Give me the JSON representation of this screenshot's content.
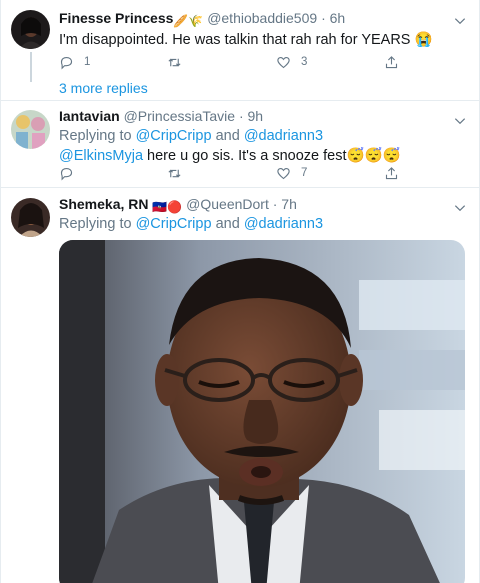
{
  "tweets": [
    {
      "display_name": "Finesse Princess",
      "name_emojis": "🥖🌾",
      "handle": "@ethiobaddie509",
      "time": "· 6h",
      "text": "I'm disappointed. He was talkin that rah rah for YEARS 😭",
      "reply_count": "1",
      "retweet_count": "",
      "like_count": "3",
      "more_replies": "3 more replies"
    },
    {
      "display_name": "Iantavian",
      "handle": "@PrincessiaTavie",
      "time": "· 9h",
      "replying_prefix": "Replying to",
      "replying_to_1": "@CripCripp",
      "replying_and": "and",
      "replying_to_2": "@dadriann3",
      "mention": "@ElkinsMyja",
      "text": " here u go sis. It's a snooze fest",
      "trailing_emojis": "😴😴😴",
      "reply_count": "",
      "retweet_count": "",
      "like_count": "7"
    },
    {
      "display_name": "Shemeka, RN",
      "name_emojis": "🇭🇹🔴",
      "handle": "@QueenDort",
      "time": "· 7h",
      "replying_prefix": "Replying to",
      "replying_to_1": "@CripCripp",
      "replying_and": "and",
      "replying_to_2": "@dadriann3"
    }
  ],
  "icons": {
    "reply": "reply-icon",
    "retweet": "retweet-icon",
    "like": "like-icon",
    "share": "share-icon",
    "caret": "chevron-down-icon"
  },
  "colors": {
    "link": "#1b95e0",
    "secondary": "#657786",
    "border": "#e6ecf0"
  }
}
